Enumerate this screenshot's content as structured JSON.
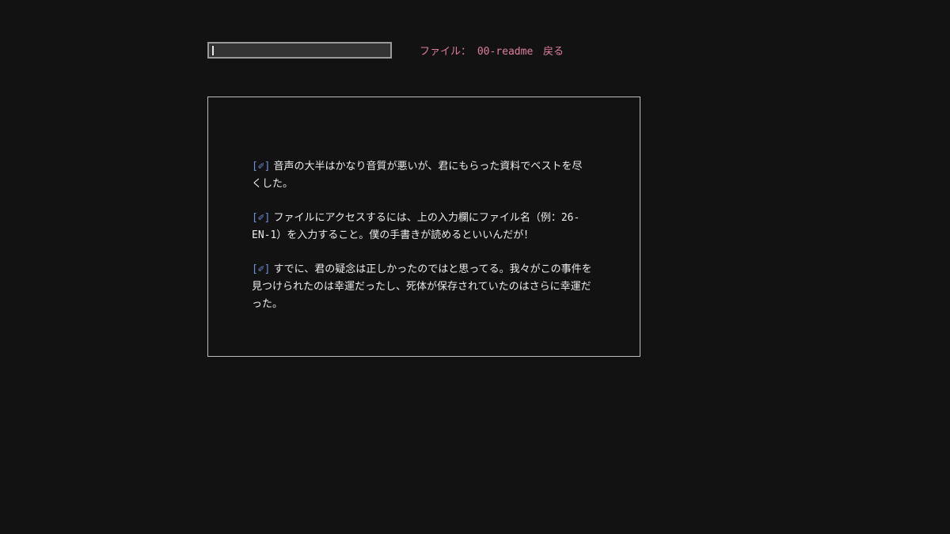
{
  "search": {
    "value": "",
    "placeholder": ""
  },
  "header": {
    "file_label": "ファイル： 00-readme",
    "back_label": "戻る"
  },
  "content": {
    "icon": "note-icon",
    "icon_glyph": "[✐]",
    "messages": [
      "音声の大半はかなり音質が悪いが、君にもらった資料でベストを尽くした。",
      "ファイルにアクセスするには、上の入力欄にファイル名（例：26-EN-1）を入力すること。僕の手書きが読めるといいんだが！",
      "すでに、君の疑念は正しかったのではと思ってる。我々がこの事件を見つけられたのは幸運だったし、死体が保存されていたのはさらに幸運だった。"
    ]
  },
  "colors": {
    "background": "#121212",
    "accent_pink": "#e07ea0",
    "icon_blue": "#6f8ed8",
    "text": "#ececec"
  }
}
